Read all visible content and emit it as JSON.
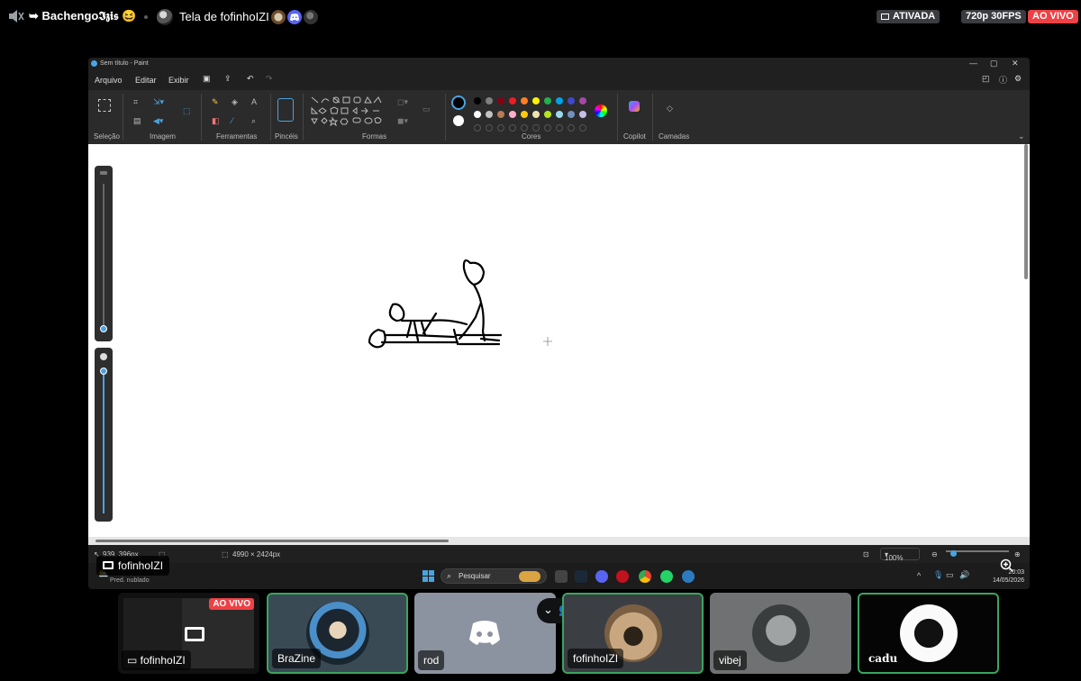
{
  "top_bar": {
    "user_label": "➥ Bachengo𝕴𝖟𝖎𝖘 😆",
    "screen_title": "Tela de fofinhoIZI",
    "activated_badge": "ATIVADA",
    "quality_badge": "720p 30FPS",
    "live_badge": "AO VIVO"
  },
  "paint": {
    "window_title": "Sem título - Paint",
    "menu": [
      "Arquivo",
      "Editar",
      "Exibir"
    ],
    "groups": [
      "Seleção",
      "Imagem",
      "Ferramentas",
      "Pincéis",
      "Formas",
      "Cores",
      "Copilot",
      "Camadas"
    ],
    "colors_row1": [
      "#000000",
      "#7f7f7f",
      "#880015",
      "#ed1c24",
      "#ff7f27",
      "#fff200",
      "#22b14c",
      "#00a2e8",
      "#3f48cc",
      "#a349a4"
    ],
    "colors_row2": [
      "#ffffff",
      "#c3c3c3",
      "#b97a57",
      "#ffaec9",
      "#ffc90e",
      "#efe4b0",
      "#b5e61d",
      "#99d9ea",
      "#7092be",
      "#c8bfe7"
    ],
    "status": {
      "cursor_pos": "939, 396px",
      "canvas_size": "4990 × 2424px",
      "zoom": "100%"
    },
    "taskbar": {
      "search_placeholder": "Pesquisar",
      "weather": "Pred. nublado",
      "time": "20:03",
      "date": "14/05/2026"
    }
  },
  "stream": {
    "streamer_name": "fofinhoIZI"
  },
  "participants": [
    {
      "name": "fofinhoIZI",
      "live": "AO VIVO"
    },
    {
      "name": "BraZine"
    },
    {
      "name": "rod"
    },
    {
      "name": "fofinhoIZI"
    },
    {
      "name": "vibej"
    },
    {
      "name": "cadu"
    }
  ],
  "colors": {
    "live_red": "#ed4245",
    "speaking_green": "#3ba55d",
    "discord_blurple": "#5865f2"
  }
}
